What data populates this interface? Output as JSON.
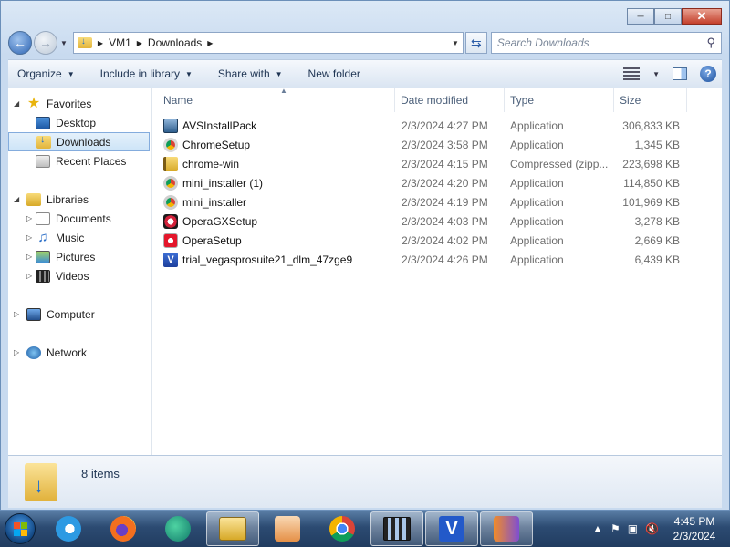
{
  "window": {
    "minimize_icon": "minimize-icon",
    "maximize_icon": "maximize-icon",
    "close_icon": "close-icon"
  },
  "address": {
    "crumbs": [
      "VM1",
      "Downloads"
    ],
    "search_placeholder": "Search Downloads"
  },
  "toolbar": {
    "organize": "Organize",
    "include_in_library": "Include in library",
    "share_with": "Share with",
    "new_folder": "New folder"
  },
  "sidebar": {
    "favorites": "Favorites",
    "desktop": "Desktop",
    "downloads": "Downloads",
    "recent_places": "Recent Places",
    "libraries": "Libraries",
    "documents": "Documents",
    "music": "Music",
    "pictures": "Pictures",
    "videos": "Videos",
    "computer": "Computer",
    "network": "Network"
  },
  "columns": {
    "name": "Name",
    "date_modified": "Date modified",
    "type": "Type",
    "size": "Size"
  },
  "files": [
    {
      "name": "AVSInstallPack",
      "date": "2/3/2024 4:27 PM",
      "type": "Application",
      "size": "306,833 KB",
      "icon": "avs-icon"
    },
    {
      "name": "ChromeSetup",
      "date": "2/3/2024 3:58 PM",
      "type": "Application",
      "size": "1,345 KB",
      "icon": "chrome-icon"
    },
    {
      "name": "chrome-win",
      "date": "2/3/2024 4:15 PM",
      "type": "Compressed (zipp...",
      "size": "223,698 KB",
      "icon": "zip-folder-icon"
    },
    {
      "name": "mini_installer (1)",
      "date": "2/3/2024 4:20 PM",
      "type": "Application",
      "size": "114,850 KB",
      "icon": "installer-icon"
    },
    {
      "name": "mini_installer",
      "date": "2/3/2024 4:19 PM",
      "type": "Application",
      "size": "101,969 KB",
      "icon": "installer-icon"
    },
    {
      "name": "OperaGXSetup",
      "date": "2/3/2024 4:03 PM",
      "type": "Application",
      "size": "3,278 KB",
      "icon": "opera-gx-icon"
    },
    {
      "name": "OperaSetup",
      "date": "2/3/2024 4:02 PM",
      "type": "Application",
      "size": "2,669 KB",
      "icon": "opera-icon"
    },
    {
      "name": "trial_vegasprosuite21_dlm_47zge9",
      "date": "2/3/2024 4:26 PM",
      "type": "Application",
      "size": "6,439 KB",
      "icon": "vegas-icon"
    }
  ],
  "details": {
    "items_count": "8 items"
  },
  "taskbar": {
    "vegas_letter": "V",
    "time": "4:45 PM",
    "date": "2/3/2024"
  }
}
